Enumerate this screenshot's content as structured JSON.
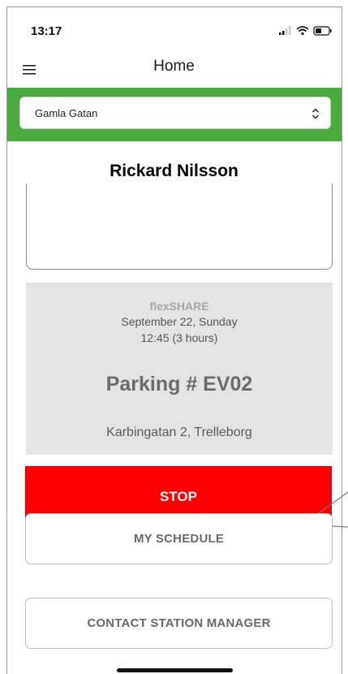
{
  "status_bar": {
    "time": "13:17",
    "icons": [
      "signal-icon",
      "wifi-icon",
      "battery-icon"
    ]
  },
  "header": {
    "title": "Home",
    "menu_icon": "hamburger-menu-icon"
  },
  "station_selector": {
    "value": "Gamla Gatan",
    "icon": "select-chevrons-icon"
  },
  "user": {
    "name": "Rickard Nilsson"
  },
  "booking": {
    "service": "flexSHARE",
    "date": "September 22, Sunday",
    "time": "12:45 (3 hours)",
    "parking": "Parking # EV02",
    "address": "Karbingatan 2, Trelleborg"
  },
  "actions": {
    "stop_label": "STOP",
    "schedule_label": "MY SCHEDULE",
    "contact_label": "CONTACT STATION MANAGER"
  },
  "colors": {
    "accent_green": "#4aaa3e",
    "stop_red": "#ff0000",
    "card_gray": "#e4e4e4"
  }
}
